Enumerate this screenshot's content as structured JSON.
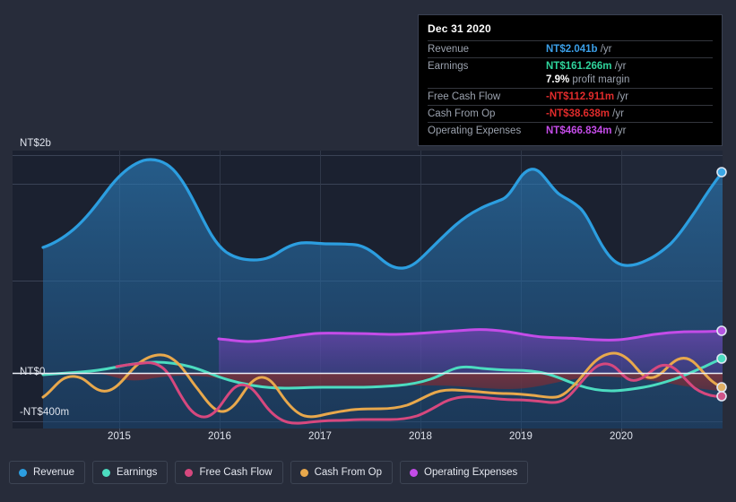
{
  "chart_data": {
    "type": "area",
    "title": "",
    "xlabel": "",
    "ylabel": "",
    "currency": "NT$",
    "x_tick_labels": [
      "2015",
      "2016",
      "2017",
      "2018",
      "2019",
      "2020"
    ],
    "y_tick_labels": [
      "NT$2b",
      "NT$0",
      "-NT$400m"
    ],
    "ylim": [
      -550000000,
      2200000000
    ],
    "grid": true,
    "legend_position": "bottom",
    "zero_line": "NT$0",
    "series": [
      {
        "name": "Revenue",
        "color": "#2c9ee0",
        "values": [
          1.19,
          1.31,
          1.56,
          1.82,
          1.94,
          1.93,
          1.74,
          1.39,
          1.24,
          1.23,
          1.29,
          1.31,
          1.27,
          1.33,
          1.34,
          1.34,
          1.23,
          1.17,
          1.28,
          1.41,
          1.5,
          1.55,
          1.72,
          1.62,
          1.58,
          1.49,
          1.38,
          1.18,
          1.16,
          1.22,
          1.42,
          1.68,
          2.041
        ],
        "unit": "NT$b"
      },
      {
        "name": "Earnings",
        "color": "#4cdcc0",
        "values": [
          -0.02,
          -0.015,
          -0.006,
          0.01,
          0.029,
          0.038,
          0.03,
          0.005,
          -0.038,
          -0.07,
          -0.078,
          -0.078,
          -0.077,
          -0.07,
          -0.062,
          -0.058,
          -0.072,
          -0.086,
          -0.08,
          -0.045,
          -0.012,
          -0.018,
          -0.022,
          -0.025,
          -0.03,
          -0.055,
          -0.088,
          -0.095,
          -0.088,
          -0.072,
          -0.03,
          0.07,
          0.161266
        ],
        "unit": "NT$b"
      },
      {
        "name": "Free Cash Flow",
        "color": "#d6487e",
        "values": [
          null,
          null,
          null,
          null,
          0.03,
          0.03,
          -0.255,
          -0.148,
          -0.42,
          -0.43,
          -0.31,
          -0.255,
          -0.25,
          -0.128,
          -0.072,
          -0.078,
          -0.09,
          -0.195,
          -0.192,
          -0.195,
          -0.198,
          -0.198,
          -0.13,
          -0.038,
          0.108,
          0.035,
          0.072,
          -0.01,
          -0.09,
          -0.112911
        ],
        "unit": "NT$b"
      },
      {
        "name": "Cash From Op",
        "color": "#e8a84c",
        "values": [
          -0.225,
          -0.06,
          -0.115,
          -0.04,
          0.106,
          0.118,
          -0.18,
          -0.04,
          -0.378,
          -0.39,
          -0.29,
          -0.24,
          -0.232,
          -0.11,
          -0.055,
          -0.05,
          -0.062,
          -0.166,
          -0.162,
          -0.168,
          -0.17,
          -0.168,
          -0.105,
          0.01,
          0.152,
          0.078,
          0.118,
          0.03,
          -0.02,
          -0.038638
        ],
        "unit": "NT$b"
      },
      {
        "name": "Operating Expenses",
        "color": "#c44ce8",
        "values": [
          0.43,
          0.428,
          0.44,
          0.452,
          0.455,
          0.452,
          0.45,
          0.458,
          0.465,
          0.468,
          0.47,
          0.472,
          0.468,
          0.46,
          0.452,
          0.456,
          0.462,
          0.466834
        ],
        "unit": "NT$b"
      }
    ]
  },
  "tooltip": {
    "date": "Dec 31 2020",
    "rows": [
      {
        "label": "Revenue",
        "value": "NT$2.041b",
        "unit": "/yr",
        "color": "#3b9fe8"
      },
      {
        "label": "Earnings",
        "value": "NT$161.266m",
        "unit": "/yr",
        "color": "#2fd49c"
      },
      {
        "label": "Free Cash Flow",
        "value": "-NT$112.911m",
        "unit": "/yr",
        "color": "#e02b2b"
      },
      {
        "label": "Cash From Op",
        "value": "-NT$38.638m",
        "unit": "/yr",
        "color": "#e02b2b"
      },
      {
        "label": "Operating Expenses",
        "value": "NT$466.834m",
        "unit": "/yr",
        "color": "#c44ce8"
      }
    ],
    "margin_value": "7.9%",
    "margin_label": "profit margin"
  },
  "y_axis": {
    "top": "NT$2b",
    "zero": "NT$0",
    "bottom": "-NT$400m"
  },
  "x_axis": {
    "ticks": [
      "2015",
      "2016",
      "2017",
      "2018",
      "2019",
      "2020"
    ]
  },
  "legend": {
    "items": [
      {
        "label": "Revenue",
        "color": "#2c9ee0"
      },
      {
        "label": "Earnings",
        "color": "#4cdcc0"
      },
      {
        "label": "Free Cash Flow",
        "color": "#d6487e"
      },
      {
        "label": "Cash From Op",
        "color": "#e8a84c"
      },
      {
        "label": "Operating Expenses",
        "color": "#c44ce8"
      }
    ]
  }
}
